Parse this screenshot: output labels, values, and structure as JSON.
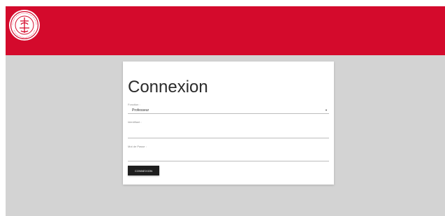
{
  "login": {
    "title": "Connexion",
    "fonction_label": "Fonction :",
    "fonction_value": "Professeur",
    "identifiant_label": "Identifiant :",
    "password_label": "Mot de Passe :",
    "submit_label": "CONNEXION"
  },
  "colors": {
    "header": "#d40a2c",
    "background": "#d3d3d3",
    "button": "#1e1e1e"
  },
  "icons": {
    "logo": "university-seal-icon",
    "select_caret": "caret-down-icon"
  }
}
